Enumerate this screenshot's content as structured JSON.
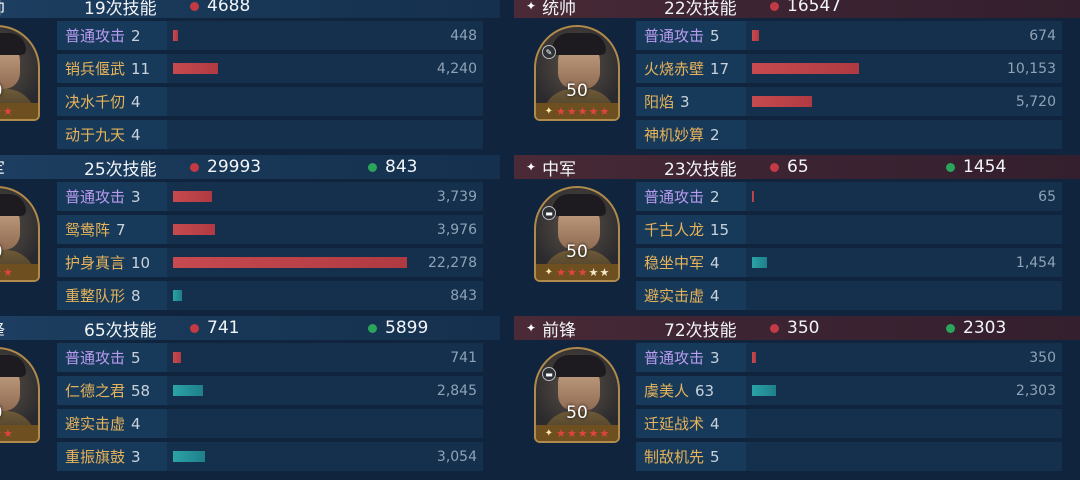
{
  "bar_max": 22278,
  "colors": {
    "damage_dot": "#c23b44",
    "heal_dot": "#2aa55a",
    "damage_bar": "#c64a4f",
    "heal_bar": "#2aa3a6",
    "normal_attack_text": "#b99bef",
    "skill_text": "#e6b35a"
  },
  "teams": [
    {
      "id": "left",
      "generals": [
        {
          "position": "帅",
          "skill_count": "19次技能",
          "damage": "4688",
          "heal": null,
          "level": "0",
          "stars_red": 3,
          "stars_white": 0,
          "skills": [
            {
              "name": "普通攻击",
              "type": "normal",
              "times": "2",
              "value": "448",
              "bar": "damage",
              "amount": 448
            },
            {
              "name": "销兵偃武",
              "type": "skill",
              "times": "11",
              "value": "4,240",
              "bar": "damage",
              "amount": 4240
            },
            {
              "name": "决水千仞",
              "type": "skill",
              "times": "4",
              "value": "",
              "bar": null,
              "amount": 0
            },
            {
              "name": "动于九天",
              "type": "skill",
              "times": "4",
              "value": "",
              "bar": null,
              "amount": 0
            }
          ]
        },
        {
          "position": "军",
          "skill_count": "25次技能",
          "damage": "29993",
          "heal": "843",
          "level": "0",
          "stars_red": 3,
          "stars_white": 0,
          "skills": [
            {
              "name": "普通攻击",
              "type": "normal",
              "times": "3",
              "value": "3,739",
              "bar": "damage",
              "amount": 3739
            },
            {
              "name": "鸳鸯阵",
              "type": "skill",
              "times": "7",
              "value": "3,976",
              "bar": "damage",
              "amount": 3976
            },
            {
              "name": "护身真言",
              "type": "skill",
              "times": "10",
              "value": "22,278",
              "bar": "damage",
              "amount": 22278
            },
            {
              "name": "重整队形",
              "type": "skill",
              "times": "8",
              "value": "843",
              "bar": "heal",
              "amount": 843
            }
          ]
        },
        {
          "position": "锋",
          "skill_count": "65次技能",
          "damage": "741",
          "heal": "5899",
          "level": "0",
          "stars_red": 3,
          "stars_white": 0,
          "skills": [
            {
              "name": "普通攻击",
              "type": "normal",
              "times": "5",
              "value": "741",
              "bar": "damage",
              "amount": 741
            },
            {
              "name": "仁德之君",
              "type": "skill",
              "times": "58",
              "value": "2,845",
              "bar": "heal",
              "amount": 2845
            },
            {
              "name": "避实击虚",
              "type": "skill",
              "times": "4",
              "value": "",
              "bar": null,
              "amount": 0
            },
            {
              "name": "重振旗鼓",
              "type": "skill",
              "times": "3",
              "value": "3,054",
              "bar": "heal",
              "amount": 3054
            }
          ]
        }
      ]
    },
    {
      "id": "right",
      "generals": [
        {
          "position": "统帅",
          "skill_count": "22次技能",
          "damage": "16547",
          "heal": null,
          "level": "50",
          "stars_red": 5,
          "stars_white": 0,
          "badge": "flame-badge-icon",
          "skills": [
            {
              "name": "普通攻击",
              "type": "normal",
              "times": "5",
              "value": "674",
              "bar": "damage",
              "amount": 674
            },
            {
              "name": "火烧赤壁",
              "type": "skill",
              "times": "17",
              "value": "10,153",
              "bar": "damage",
              "amount": 10153
            },
            {
              "name": "阳焰",
              "type": "skill",
              "times": "3",
              "value": "5,720",
              "bar": "damage",
              "amount": 5720
            },
            {
              "name": "神机妙算",
              "type": "skill",
              "times": "2",
              "value": "",
              "bar": null,
              "amount": 0
            }
          ]
        },
        {
          "position": "中军",
          "skill_count": "23次技能",
          "damage": "65",
          "heal": "1454",
          "level": "50",
          "stars_red": 3,
          "stars_white": 2,
          "badge": "shield-badge-icon",
          "skills": [
            {
              "name": "普通攻击",
              "type": "normal",
              "times": "2",
              "value": "65",
              "bar": "damage",
              "amount": 65
            },
            {
              "name": "千古人龙",
              "type": "skill",
              "times": "15",
              "value": "",
              "bar": null,
              "amount": 0
            },
            {
              "name": "稳坐中军",
              "type": "skill",
              "times": "4",
              "value": "1,454",
              "bar": "heal",
              "amount": 1454
            },
            {
              "name": "避实击虚",
              "type": "skill",
              "times": "4",
              "value": "",
              "bar": null,
              "amount": 0
            }
          ]
        },
        {
          "position": "前锋",
          "skill_count": "72次技能",
          "damage": "350",
          "heal": "2303",
          "level": "50",
          "stars_red": 5,
          "stars_white": 0,
          "badge": "shield-badge-icon",
          "skills": [
            {
              "name": "普通攻击",
              "type": "normal",
              "times": "3",
              "value": "350",
              "bar": "damage",
              "amount": 350
            },
            {
              "name": "虞美人",
              "type": "skill",
              "times": "63",
              "value": "2,303",
              "bar": "heal",
              "amount": 2303
            },
            {
              "name": "迁延战术",
              "type": "skill",
              "times": "4",
              "value": "",
              "bar": null,
              "amount": 0
            },
            {
              "name": "制敌机先",
              "type": "skill",
              "times": "5",
              "value": "",
              "bar": null,
              "amount": 0
            }
          ]
        }
      ]
    }
  ]
}
